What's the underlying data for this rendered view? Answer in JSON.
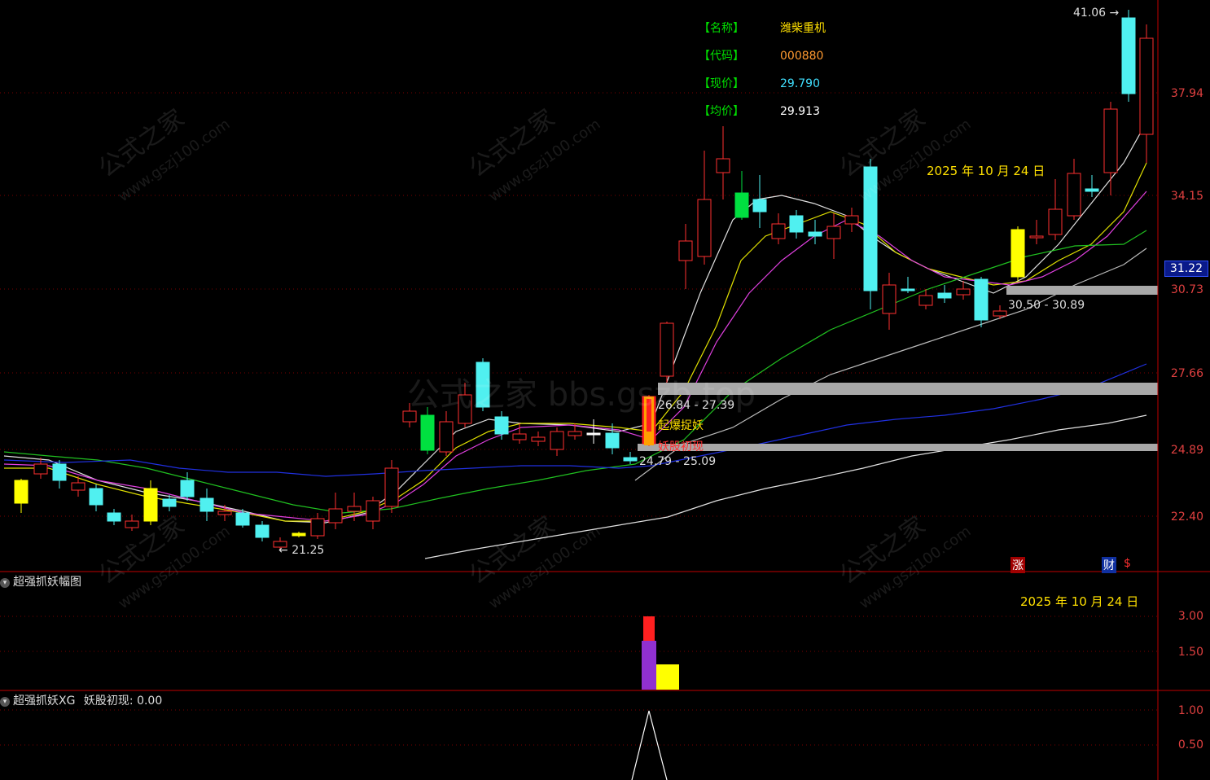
{
  "info_panel": {
    "rows": [
      {
        "label": "【名称】",
        "value": "潍柴重机",
        "color": "#ffe000"
      },
      {
        "label": "【代码】",
        "value": "000880",
        "color": "#ff9a30"
      },
      {
        "label": "【现价】",
        "value": "29.790",
        "color": "#40e0ff"
      },
      {
        "label": "【均价】",
        "value": "29.913",
        "color": "#ffffff"
      }
    ]
  },
  "price_axis": [
    "37.94",
    "34.15",
    "30.73",
    "27.66",
    "24.89",
    "22.40"
  ],
  "current_price_tag": "31.22",
  "top_high_label": "41.06",
  "low_label": "21.25",
  "date_label_main": "2025 年 10 月 24 日",
  "date_label_sub": "2025 年 10 月 24 日",
  "zone_labels": {
    "zone_upper": "30.50 - 30.89",
    "zone_middle": "26.84 - 27.39",
    "zone_lower": "24.79 - 25.09"
  },
  "signal_labels": {
    "boom": "起爆捉妖",
    "first_appear": "妖股初现"
  },
  "watermark_center": "公式之家 bbs.gszb.top",
  "watermark_diag": [
    "公式之家",
    "www.gszj100.com"
  ],
  "badges": {
    "rise": "涨",
    "finance": "财",
    "s": "$"
  },
  "pane2": {
    "title": "超强抓妖幅图",
    "axis": [
      "3.00",
      "1.50"
    ]
  },
  "pane3": {
    "title": "超强抓妖XG",
    "indicator_text": "妖股初现: 0.00",
    "axis": [
      "1.00",
      "0.50"
    ]
  },
  "colors": {
    "up_candle": "#ff3030",
    "down_candle": "#50f0f0",
    "signal_yellow": "#ffff00",
    "signal_green": "#00e040",
    "ma_white": "#e0e0e0",
    "ma_yellow": "#e0e000",
    "ma_magenta": "#e040e0",
    "ma_green": "#20c020",
    "ma_blue": "#2030e0",
    "separator": "#c00000"
  }
}
